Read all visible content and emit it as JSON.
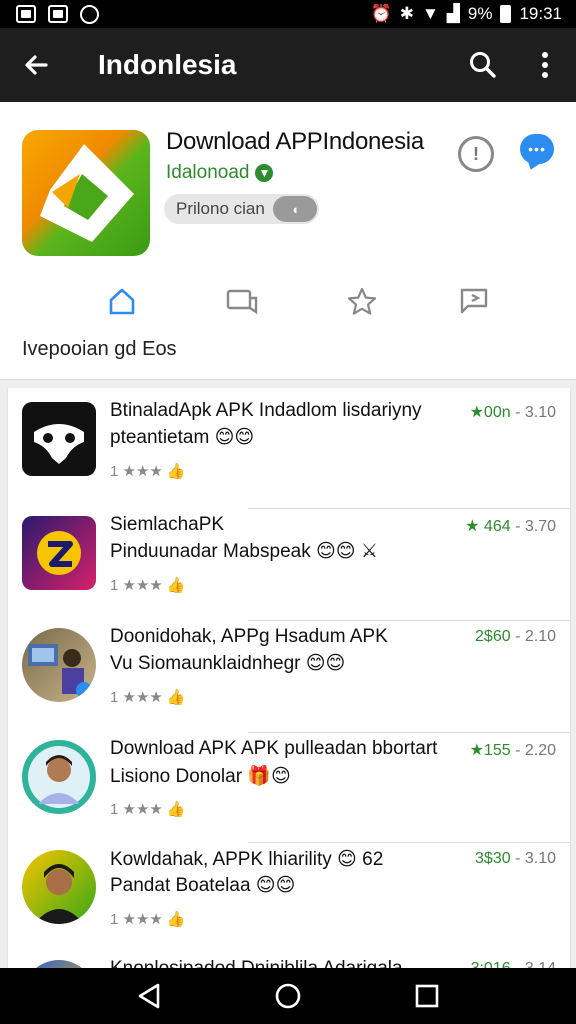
{
  "status_bar": {
    "battery": "9%",
    "time": "19:31"
  },
  "app_bar": {
    "title": "Indonlesia"
  },
  "app": {
    "title": "Download APPIndonesia",
    "developer": "Idalonoad",
    "chip_label": "Prilono cian",
    "section_label": "Ivepooian gd Eos"
  },
  "list": {
    "items": [
      {
        "line1": "BtinaladApk APK Indadlom lisdariyny",
        "line2": "pteantietam 😊😊",
        "meta": "1 ★★★",
        "rating_a": "★00n",
        "rating_b": "- 3.10"
      },
      {
        "line1": "SiemlachaPK",
        "line2": "Pinduunadar Mabspeak 😊😊 ⚔",
        "meta": "1 ★★★",
        "rating_a": "★ 464",
        "rating_b": "- 3.70"
      },
      {
        "line1": "Doonidohak, APPg Hsadum APK",
        "line2": "Vu Siomaunklaidnhegr 😊😊",
        "meta": "1 ★★★",
        "rating_a": "2$60",
        "rating_b": "- 2.10"
      },
      {
        "line1": "Download APK APK pulleadan bbortart",
        "line2": "Lisiono Donolar 🎁😊",
        "meta": "1 ★★★",
        "rating_a": "★155",
        "rating_b": "- 2.20"
      },
      {
        "line1": "Kowldahak, APPK lhiarility 😊 62",
        "line2": "Pandat Boatelaa 😊😊",
        "meta": "1 ★★★",
        "rating_a": "3$30",
        "rating_b": "- 3.10"
      },
      {
        "line1": "Knonlosipadod Dniniblila Adarigala",
        "line2": "",
        "meta": "",
        "rating_a": "3:016",
        "rating_b": "- 3.14"
      }
    ]
  },
  "colors": {
    "app_bar_bg": "#1e1e1e",
    "accent_blue": "#2c8df0",
    "dev_green": "#2e8b2e"
  }
}
